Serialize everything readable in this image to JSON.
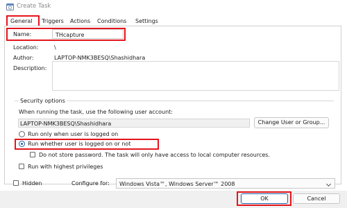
{
  "window": {
    "title": "Create Task"
  },
  "tabs": [
    {
      "label": "General"
    },
    {
      "label": "Triggers"
    },
    {
      "label": "Actions"
    },
    {
      "label": "Conditions"
    },
    {
      "label": "Settings"
    }
  ],
  "general": {
    "name_label": "Name:",
    "name_value": "THcapture",
    "location_label": "Location:",
    "location_value": "\\",
    "author_label": "Author:",
    "author_value": "LAPTOP-NMK3BESQ\\Shashidhara",
    "description_label": "Description:",
    "description_value": ""
  },
  "security": {
    "group_title": "Security options",
    "prompt": "When running the task, use the following user account:",
    "account": "LAPTOP-NMK3BESQ\\Shashidhara",
    "change_button": "Change User or Group...",
    "radio_logged_on": "Run only when user is logged on",
    "radio_whether": "Run whether user is logged on or not",
    "selected_radio": "Run whether user is logged on or not",
    "no_store_password": "Do not store password.  The task will only have access to local computer resources.",
    "highest_privileges": "Run with highest privileges"
  },
  "bottom": {
    "hidden_label": "Hidden",
    "configure_label": "Configure for:",
    "configure_value": "Windows Vista™, Windows Server™ 2008",
    "ok_label": "OK",
    "cancel_label": "Cancel"
  },
  "colors": {
    "highlight": "#e5141b",
    "accent": "#1f5fa8"
  }
}
